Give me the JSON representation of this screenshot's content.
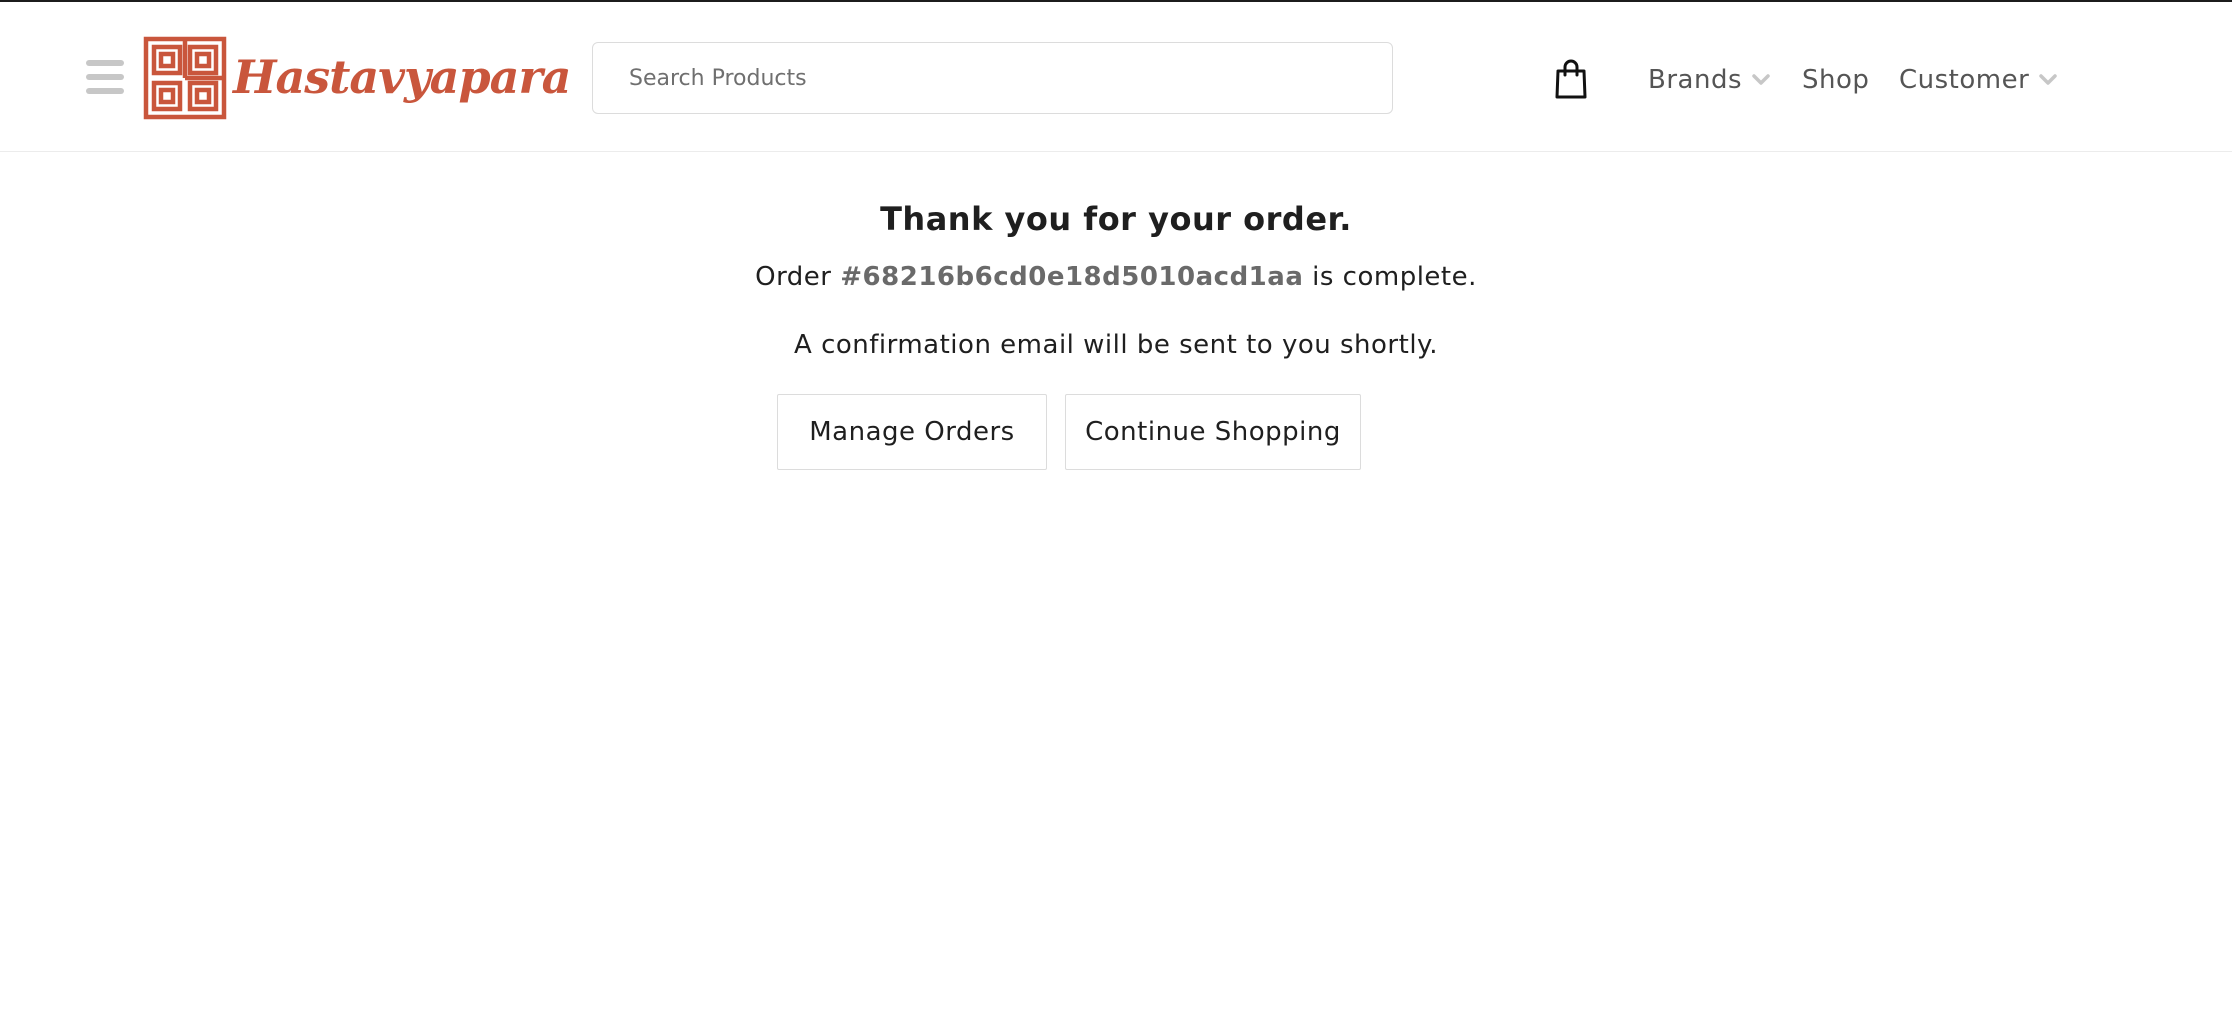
{
  "header": {
    "logo_text": "Hastavyapara",
    "search_placeholder": "Search Products",
    "nav": {
      "brands": "Brands",
      "shop": "Shop",
      "customer": "Customer"
    },
    "icons": [
      "hamburger-icon",
      "logo-mark-icon",
      "shopping-bag-icon",
      "chevron-down-icon"
    ],
    "colors": {
      "brand": "#c9563c",
      "muted_icon": "#c7c7c7"
    }
  },
  "main": {
    "title": "Thank you for your order.",
    "order_prefix": "Order",
    "order_id": "#68216b6cd0e18d5010acd1aa",
    "order_suffix": "is complete.",
    "confirmation": "A confirmation email will be sent to you shortly.",
    "buttons": {
      "manage_orders": "Manage Orders",
      "continue_shopping": "Continue Shopping"
    }
  }
}
